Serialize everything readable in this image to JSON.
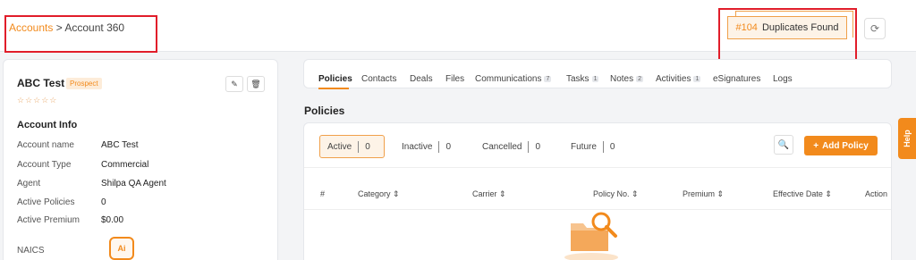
{
  "breadcrumb": {
    "root": "Accounts",
    "sep": " > ",
    "current": "Account 360"
  },
  "duplicates": {
    "number": "#104",
    "label": "Duplicates Found"
  },
  "account": {
    "name": "ABC Test",
    "status": "Prospect",
    "stars": "☆☆☆☆☆",
    "section_title": "Account Info",
    "info": [
      {
        "label": "Account name",
        "value": "ABC Test"
      },
      {
        "label": "Account Type",
        "value": "Commercial"
      },
      {
        "label": "Agent",
        "value": "Shilpa QA Agent"
      },
      {
        "label": "Active Policies",
        "value": "0"
      },
      {
        "label": "Active Premium",
        "value": "$0.00"
      }
    ],
    "naics_label": "NAICS",
    "ai_label": "Ai"
  },
  "tabs": [
    {
      "label": "Policies",
      "count": ""
    },
    {
      "label": "Contacts",
      "count": ""
    },
    {
      "label": "Deals",
      "count": ""
    },
    {
      "label": "Files",
      "count": ""
    },
    {
      "label": "Communications",
      "count": "7"
    },
    {
      "label": "Tasks",
      "count": "1"
    },
    {
      "label": "Notes",
      "count": "2"
    },
    {
      "label": "Activities",
      "count": "1"
    },
    {
      "label": "eSignatures",
      "count": ""
    },
    {
      "label": "Logs",
      "count": ""
    }
  ],
  "policies": {
    "heading": "Policies",
    "filters": [
      {
        "label": "Active",
        "count": "0"
      },
      {
        "label": "Inactive",
        "count": "0"
      },
      {
        "label": "Cancelled",
        "count": "0"
      },
      {
        "label": "Future",
        "count": "0"
      }
    ],
    "add_label": "Add Policy",
    "columns": [
      "#",
      "Category ⇕",
      "Carrier ⇕",
      "Policy No. ⇕",
      "Premium ⇕",
      "Effective Date ⇕",
      "Action"
    ]
  },
  "help": {
    "label": "Help"
  },
  "colors": {
    "accent": "#f28a1c",
    "annotation": "#e11d2a"
  }
}
